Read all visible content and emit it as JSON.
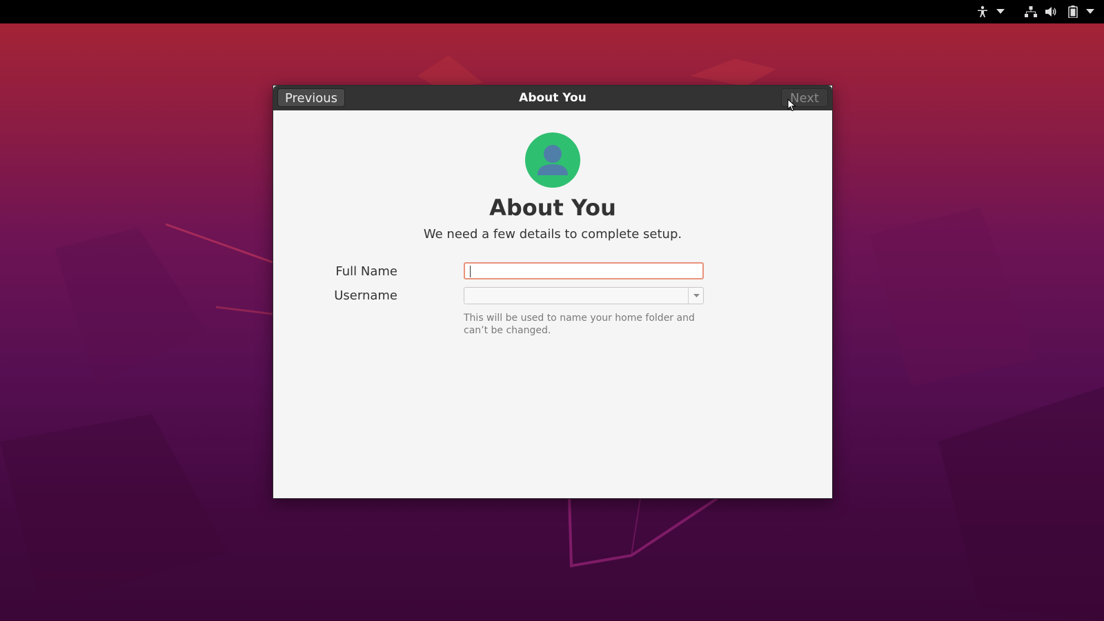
{
  "window": {
    "title": "About You",
    "previous_label": "Previous",
    "next_label": "Next"
  },
  "page": {
    "heading": "About You",
    "subheading": "We need a few details to complete setup."
  },
  "form": {
    "full_name": {
      "label": "Full Name",
      "value": ""
    },
    "username": {
      "label": "Username",
      "value": "",
      "hint": "This will be used to name your home folder and can’t be changed."
    }
  },
  "system_tray": {
    "icons": [
      "accessibility-icon",
      "chevron-down-icon",
      "network-icon",
      "volume-icon",
      "battery-icon",
      "chevron-down-icon"
    ]
  },
  "colors": {
    "avatar_bg": "#2fbf71",
    "focus_border": "#e9927a",
    "titlebar": "#333333"
  }
}
